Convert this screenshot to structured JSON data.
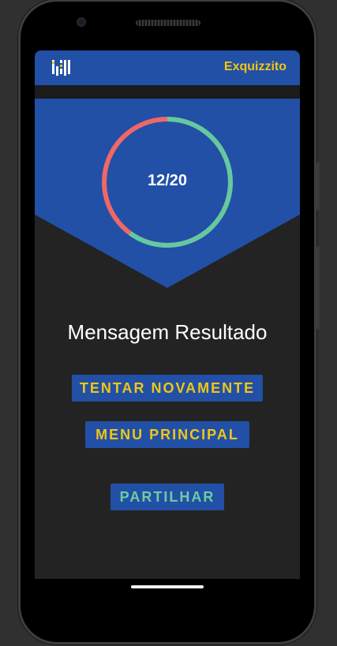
{
  "app": {
    "title": "Exquizzito",
    "logo_icon": "quiz-logo-icon"
  },
  "score": {
    "text": "12/20",
    "correct": 12,
    "total": 20,
    "correct_color": "#63c9a0",
    "wrong_color": "#f06768"
  },
  "result": {
    "message": "Mensagem Resultado"
  },
  "buttons": {
    "retry": "TENTAR NOVAMENTE",
    "main_menu": "MENU PRINCIPAL",
    "share": "PARTILHAR"
  },
  "colors": {
    "accent_blue": "#2150a6",
    "accent_yellow": "#f1c614",
    "accent_green": "#6dcca0",
    "background": "#232323"
  }
}
